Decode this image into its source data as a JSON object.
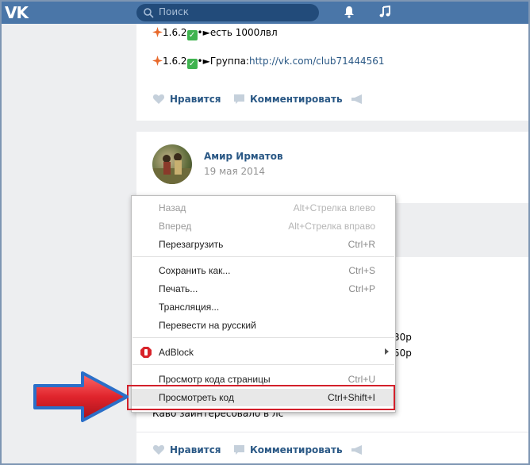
{
  "topbar": {
    "logo": "VK",
    "search_placeholder": "Поиск"
  },
  "post1": {
    "line1": "1.6.2",
    "line1_tail": "•►есть 1000лвл",
    "line2": "1.6.2",
    "line2_tail": "•►Группа:",
    "line2_link": "http://vk.com/club71444561",
    "like_label": "Нравится",
    "comment_label": "Комментировать"
  },
  "post2": {
    "author": "Амир Ирматов",
    "date": "19 мая 2014"
  },
  "post3": {
    "price1": "30р",
    "price2": "50р",
    "text": "Каво заинтересовало в лс",
    "like_label": "Нравится",
    "comment_label": "Комментировать"
  },
  "context_menu": {
    "items": [
      {
        "label": "Назад",
        "shortcut": "Alt+Стрелка влево"
      },
      {
        "label": "Вперед",
        "shortcut": "Alt+Стрелка вправо"
      },
      {
        "label": "Перезагрузить",
        "shortcut": "Ctrl+R"
      },
      {
        "label": "Сохранить как...",
        "shortcut": "Ctrl+S"
      },
      {
        "label": "Печать...",
        "shortcut": "Ctrl+P"
      },
      {
        "label": "Трансляция...",
        "shortcut": ""
      },
      {
        "label": "Перевести на русский",
        "shortcut": ""
      },
      {
        "label": "AdBlock",
        "shortcut": ""
      },
      {
        "label": "Просмотр кода страницы",
        "shortcut": "Ctrl+U"
      },
      {
        "label": "Просмотреть код",
        "shortcut": "Ctrl+Shift+I"
      }
    ]
  },
  "colors": {
    "header": "#4a76a8",
    "link": "#2a5885",
    "highlight_border": "#d3202b",
    "arrow": "#e0242c"
  }
}
